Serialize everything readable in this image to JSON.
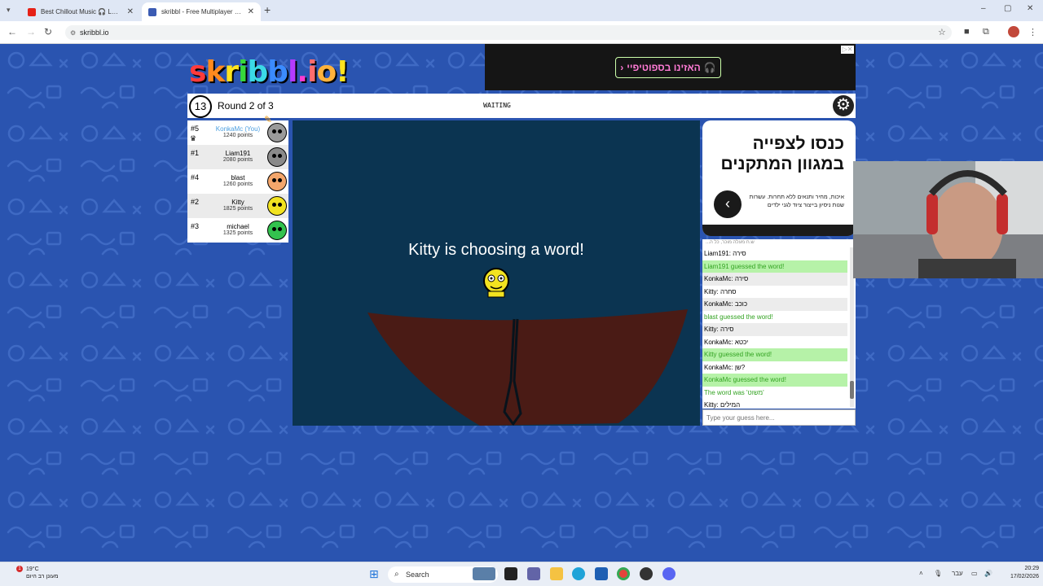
{
  "browser": {
    "tabs": [
      {
        "title": "Best Chillout Music 🎧 LOUNGE",
        "active": false,
        "favicon_color": "#e62117"
      },
      {
        "title": "skribbl - Free Multiplayer Draw",
        "active": true,
        "favicon_color": "#3b5bb3"
      }
    ],
    "new_tab": "+",
    "url": "skribbl.io",
    "window_controls": [
      "–",
      "▢",
      "✕"
    ]
  },
  "ad_top": {
    "button_text": "האזינו בספוטיפיי",
    "headphones_icon": "🎧",
    "chevron": "‹"
  },
  "logo": {
    "letters": [
      "s",
      "k",
      "r",
      "i",
      "b",
      "b",
      "l",
      ".",
      "i",
      "o",
      "!"
    ],
    "colors": [
      "#ff3b3b",
      "#ff8a1e",
      "#ffe31e",
      "#37d93b",
      "#3bd9e6",
      "#3b8bff",
      "#b43bff",
      "#ff3bd1",
      "#ff6d6d",
      "#ffb23b",
      "#ffe31e"
    ]
  },
  "game": {
    "timer": "13",
    "round_text": "Round 2 of 3",
    "status": "WAITING"
  },
  "players": [
    {
      "rank": "#5",
      "name": "KonkaMc (You)",
      "points": "1240 points",
      "you": true,
      "crown": true,
      "drawing": true,
      "face_color": "#9a9a9a"
    },
    {
      "rank": "#1",
      "name": "Liam191",
      "points": "2080 points",
      "you": false,
      "crown": false,
      "drawing": false,
      "face_color": "#8a8a8a"
    },
    {
      "rank": "#4",
      "name": "blast",
      "points": "1260 points",
      "you": false,
      "crown": false,
      "drawing": false,
      "face_color": "#f4a66b"
    },
    {
      "rank": "#2",
      "name": "Kitty",
      "points": "1825 points",
      "you": false,
      "crown": false,
      "drawing": false,
      "face_color": "#f2e320"
    },
    {
      "rank": "#3",
      "name": "michael",
      "points": "1325 points",
      "you": false,
      "crown": false,
      "drawing": false,
      "face_color": "#33c24e"
    }
  ],
  "canvas": {
    "message": "Kitty is choosing a word!",
    "background": "#0b3451",
    "boat_color": "#4a1b15"
  },
  "ad_side": {
    "headline": "כנסו לצפייה במגוון המתקנים",
    "subtext": "איכות, מחיר ותנאים ללא תחרות. עשרות שנות ניסיון בייצור ציוד לגני ילדים",
    "arrow": "‹",
    "note": "ש.ח מעלה מוכר, כל ה..."
  },
  "chat": {
    "messages": [
      {
        "who": "Liam191:",
        "text": " סירה",
        "type": "normal"
      },
      {
        "who": "",
        "text": "Liam191 guessed the word!",
        "type": "guess"
      },
      {
        "who": "KonkaMc:",
        "text": " סירה",
        "type": "alt"
      },
      {
        "who": "Kitty:",
        "text": " סחרה",
        "type": "normal"
      },
      {
        "who": "KonkaMc:",
        "text": " כוכב",
        "type": "alt"
      },
      {
        "who": "",
        "text": "blast guessed the word!",
        "type": "guess-plain"
      },
      {
        "who": "Kitty:",
        "text": " סירה",
        "type": "alt"
      },
      {
        "who": "KonkaMc:",
        "text": " יכטא",
        "type": "normal"
      },
      {
        "who": "",
        "text": "Kitty guessed the word!",
        "type": "guess"
      },
      {
        "who": "KonkaMc:",
        "text": " שן?",
        "type": "normal"
      },
      {
        "who": "",
        "text": "KonkaMc guessed the word!",
        "type": "guess"
      },
      {
        "who": "",
        "text": "The word was 'משוט'",
        "type": "guess-plain"
      },
      {
        "who": "Kitty:",
        "text": " המילים",
        "type": "normal"
      }
    ],
    "input_placeholder": "Type your guess here..."
  },
  "taskbar": {
    "temperature": "19°C",
    "weather_text": "מעונן רב היום",
    "notification_count": "1",
    "search_label": "Search",
    "language": "עבר",
    "time": "20:29",
    "date": "17/02/2026"
  }
}
